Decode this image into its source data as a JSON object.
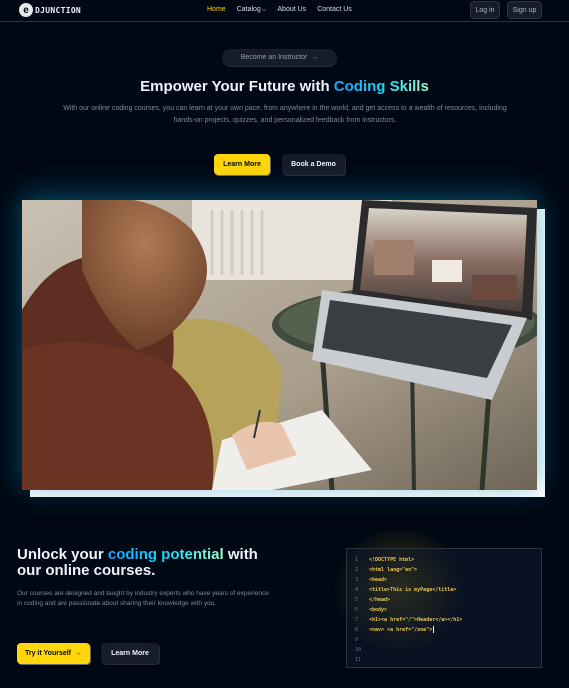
{
  "navbar": {
    "logo_letter": "e",
    "logo_text": "DJUNCTION",
    "links": [
      {
        "label": "Home",
        "active": true
      },
      {
        "label": "Catalog",
        "has_dropdown": true
      },
      {
        "label": "About Us"
      },
      {
        "label": "Contact Us"
      }
    ],
    "login_label": "Log in",
    "signup_label": "Sign up"
  },
  "hero": {
    "instructor_label": "Become an Instructor",
    "arrow": "→",
    "title_prefix": "Empower Your Future with ",
    "title_highlight": "Coding Skills",
    "description": "With our online coding courses, you can learn at your own pace, from anywhere in the world, and get access to a wealth of resources, including hands-on projects, quizzes, and personalized feedback from instructors.",
    "learn_more_label": "Learn More",
    "book_demo_label": "Book a Demo"
  },
  "section2": {
    "title_prefix": "Unlock your ",
    "title_highlight": "coding potential",
    "title_suffix1": " with",
    "title_suffix2": "our online courses.",
    "description": "Our courses are designed and taught by industry experts who have years of experience in coding and are passionate about sharing their knowledge with you.",
    "try_label": "Try it Yourself",
    "arrow": "→",
    "learn_more_label": "Learn More",
    "code_line_numbers": [
      "1",
      "2",
      "3",
      "4",
      "5",
      "6",
      "7",
      "8",
      "9",
      "10",
      "11"
    ],
    "code_lines": [
      "<!DOCTYPE html>",
      "<html lang=\"en\">",
      "<head>",
      "<title>This is myPage</title>",
      "</head>",
      "<body>",
      "<h1><a href=\"/\">Header</a></h1>",
      "<nav> <a href=\"/one\">"
    ]
  },
  "colors": {
    "background": "#000814",
    "accent_yellow": "#ffd60a",
    "highlight_gradient": [
      "#1fa2ff",
      "#12d8fa",
      "#a6ffcb"
    ],
    "code_yellow": "#e7c553"
  }
}
